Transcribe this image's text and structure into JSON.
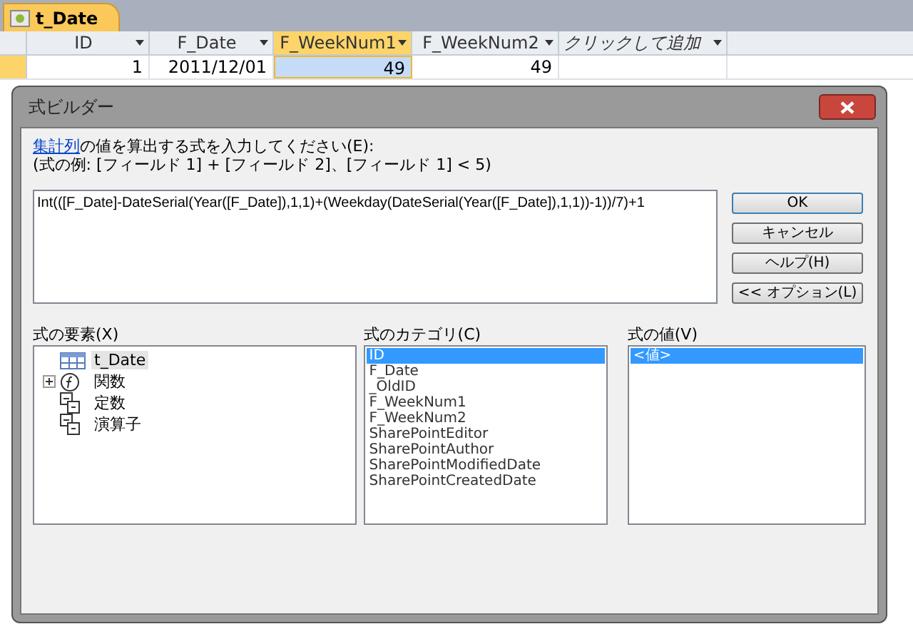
{
  "document_tab": {
    "title": "t_Date"
  },
  "datasheet": {
    "columns": [
      {
        "label": "ID",
        "selected": false,
        "kind": "field"
      },
      {
        "label": "F_Date",
        "selected": false,
        "kind": "field"
      },
      {
        "label": "F_WeekNum1",
        "selected": true,
        "kind": "field"
      },
      {
        "label": "F_WeekNum2",
        "selected": false,
        "kind": "field"
      },
      {
        "label": "クリックして追加",
        "selected": false,
        "kind": "add"
      }
    ],
    "rows": [
      {
        "cells": [
          {
            "value": "1",
            "selected": false
          },
          {
            "value": "2011/12/01",
            "selected": false
          },
          {
            "value": "49",
            "selected": true
          },
          {
            "value": "49",
            "selected": false
          },
          {
            "selected": false
          }
        ]
      }
    ]
  },
  "dialog": {
    "title": "式ビルダー",
    "prompt_link": "集計列",
    "prompt": "の値を算出する式を入力してください(E):",
    "example": "(式の例: [フィールド 1] + [フィールド 2]、[フィールド 1] < 5)",
    "expression": "Int(([F_Date]-DateSerial(Year([F_Date]),1,1)+(Weekday(DateSerial(Year([F_Date]),1,1))-1))/7)+1",
    "buttons": [
      {
        "label": "OK",
        "default": true
      },
      {
        "label": "キャンセル",
        "default": false
      },
      {
        "label": "ヘルプ(H)",
        "default": false
      },
      {
        "label": "<< オプション(L)",
        "default": false
      }
    ],
    "elements": {
      "label": "式の要素(X)",
      "items": [
        {
          "label": "t_Date",
          "kind": "table",
          "selected": true
        },
        {
          "label": "関数",
          "kind": "function",
          "selected": false,
          "expanded": false
        },
        {
          "label": "定数",
          "kind": "group",
          "selected": false
        },
        {
          "label": "演算子",
          "kind": "group",
          "selected": false
        }
      ]
    },
    "categories": {
      "label": "式のカテゴリ(C)",
      "items": [
        {
          "label": "ID",
          "selected": true
        },
        {
          "label": "F_Date",
          "selected": false
        },
        {
          "label": "_OldID",
          "selected": false
        },
        {
          "label": "F_WeekNum1",
          "selected": false
        },
        {
          "label": "F_WeekNum2",
          "selected": false
        },
        {
          "label": "SharePointEditor",
          "selected": false
        },
        {
          "label": "SharePointAuthor",
          "selected": false
        },
        {
          "label": "SharePointModifiedDate",
          "selected": false
        },
        {
          "label": "SharePointCreatedDate",
          "selected": false
        }
      ]
    },
    "values": {
      "label": "式の値(V)",
      "items": [
        {
          "label": "<値>",
          "selected": true
        }
      ]
    }
  }
}
